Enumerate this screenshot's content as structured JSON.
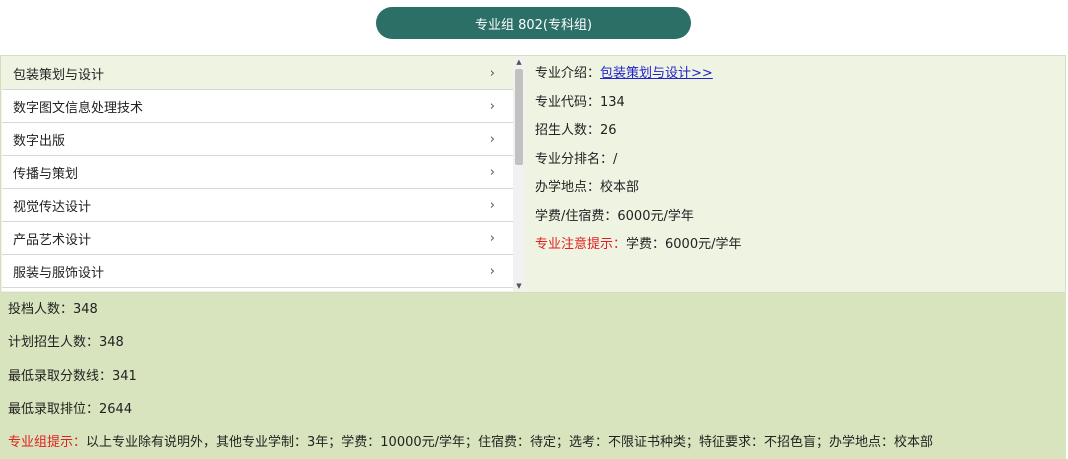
{
  "group_button": "专业组 802(专科组)",
  "majors": [
    {
      "name": "包装策划与设计",
      "chevron": "›"
    },
    {
      "name": "数字图文信息处理技术",
      "chevron": "›"
    },
    {
      "name": "数字出版",
      "chevron": "›"
    },
    {
      "name": "传播与策划",
      "chevron": "›"
    },
    {
      "name": "视觉传达设计",
      "chevron": "›"
    },
    {
      "name": "产品艺术设计",
      "chevron": "›"
    },
    {
      "name": "服装与服饰设计",
      "chevron": "›"
    }
  ],
  "selected_major_index": 0,
  "scrollbar": {
    "up_arrow": "▲",
    "down_arrow": "▼"
  },
  "details": {
    "intro_label": "专业介绍：",
    "intro_link": "包装策划与设计>>",
    "code": "专业代码：134",
    "enroll": "招生人数：26",
    "rank": "专业分排名：/",
    "location": "办学地点：校本部",
    "fee": "学费/住宿费：6000元/学年",
    "notice_label": "专业注意提示：",
    "notice_value": "学费：6000元/学年"
  },
  "summary": {
    "filed": "投档人数：348",
    "planned": "计划招生人数：348",
    "min_score": "最低录取分数线：341",
    "min_rank": "最低录取排位：2644",
    "tip_label": "专业组提示：",
    "tip_value": "以上专业除有说明外，其他专业学制：3年；学费：10000元/学年；住宿费：待定；选考：不限证书种类；特征要求：不招色盲；办学地点：校本部"
  },
  "colors": {
    "accent": "#2c6f67",
    "panel_bg": "#eef3e2",
    "summary_bg": "#d8e4bd",
    "notice": "#e02020",
    "link": "#2222cc"
  }
}
